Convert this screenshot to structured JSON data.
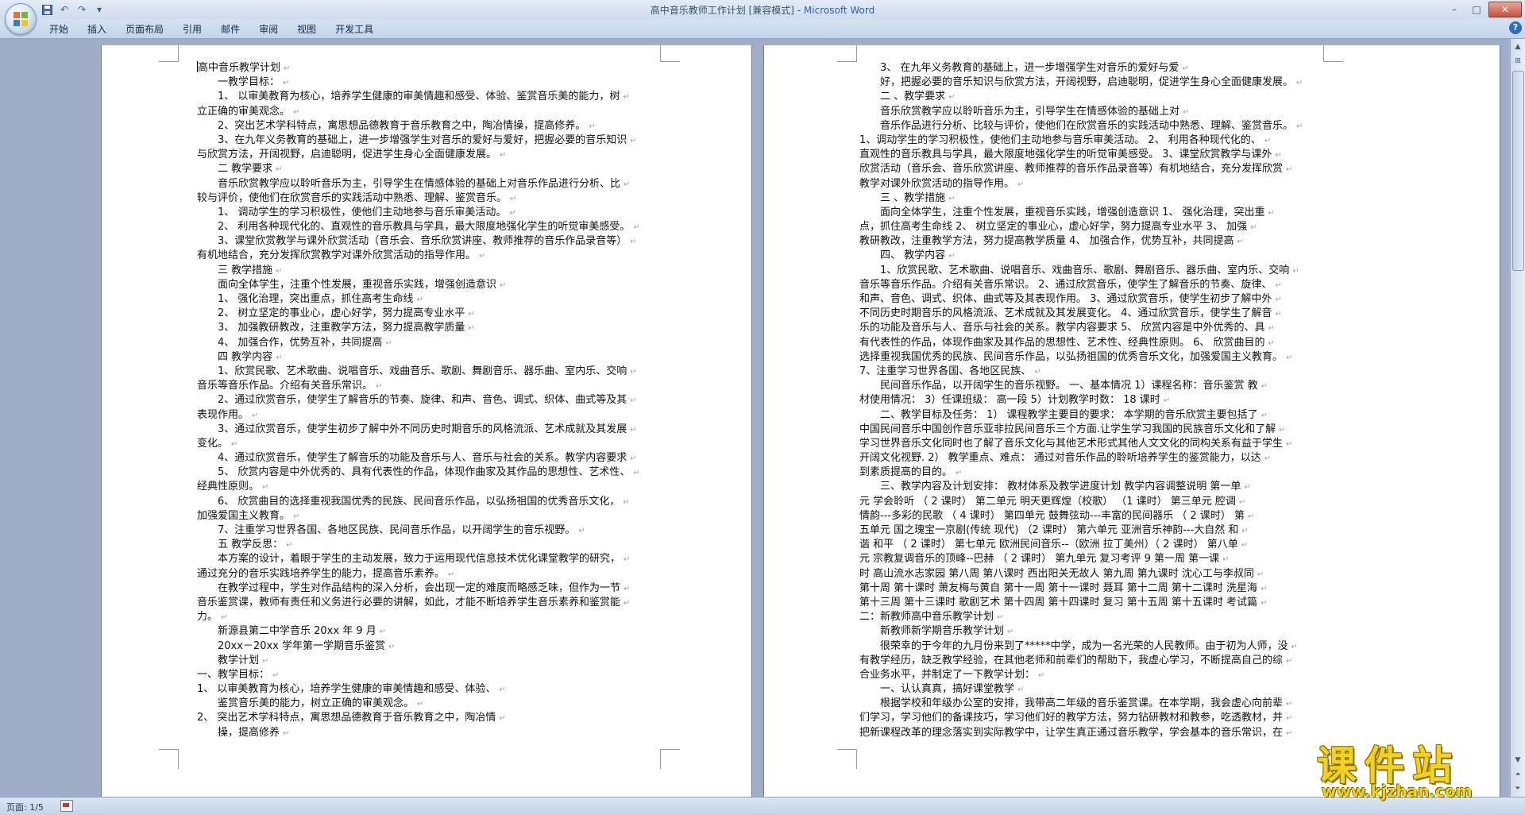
{
  "window": {
    "title_prefix": "高中音乐教师工作计划 [兼容模式] - ",
    "title_app": "Microsoft Word"
  },
  "quick_access": [
    "save-icon",
    "undo-icon",
    "redo-icon",
    "customize-icon"
  ],
  "window_controls": {
    "minimize": "–",
    "maximize": "□",
    "close": "✕"
  },
  "ribbon": {
    "tabs": [
      "开始",
      "插入",
      "页面布局",
      "引用",
      "邮件",
      "审阅",
      "视图",
      "开发工具"
    ],
    "help": "?"
  },
  "colors": {
    "ribbon_bg": "#c3d4ea",
    "doc_bg": "#9faec6",
    "close_btn": "#c4513d",
    "watermark": "#f2d21a"
  },
  "left_page": {
    "lines": [
      {
        "t": "高中音乐教学计划",
        "i": 0
      },
      {
        "t": "一教学目标：",
        "i": 1
      },
      {
        "t": "1、 以审美教育为核心，培养学生健康的审美情趣和感受、体验、鉴赏音乐美的能力，树",
        "i": 1
      },
      {
        "t": "立正确的审美观念。",
        "i": 0
      },
      {
        "t": "2、突出艺术学科特点，寓思想品德教育于音乐教育之中，陶冶情操，提高修养。",
        "i": 1
      },
      {
        "t": "3、在九年义务教育的基础上，进一步增强学生对音乐的爱好与爱好，把握必要的音乐知识",
        "i": 1
      },
      {
        "t": "与欣赏方法，开阔视野，启迪聪明，促进学生身心全面健康发展。",
        "i": 0
      },
      {
        "t": "二 教学要求",
        "i": 1
      },
      {
        "t": "音乐欣赏教学应以聆听音乐为主，引导学生在情感体验的基础上对音乐作品进行分析、比",
        "i": 1
      },
      {
        "t": "较与评价，使他们在欣赏音乐的实践活动中熟悉、理解、鉴赏音乐。",
        "i": 0
      },
      {
        "t": "1、  调动学生的学习积极性，使他们主动地参与音乐审美活动。",
        "i": 1
      },
      {
        "t": "2、  利用各种现代化的、直观性的音乐教具与学具，最大限度地强化学生的听觉审美感受。",
        "i": 1
      },
      {
        "t": "3、课堂欣赏教学与课外欣赏活动（音乐会、音乐欣赏讲座、教师推荐的音乐作品录音等）",
        "i": 1
      },
      {
        "t": "有机地结合，充分发挥欣赏教学对课外欣赏活动的指导作用。",
        "i": 0
      },
      {
        "t": "三 教学措施",
        "i": 1
      },
      {
        "t": "面向全体学生，注重个性发展，重视音乐实践，增强创造意识",
        "i": 1
      },
      {
        "t": "1、   强化治理，突出重点，抓住高考生命线",
        "i": 1
      },
      {
        "t": "2、   树立坚定的事业心，虚心好学，努力提高专业水平",
        "i": 1
      },
      {
        "t": "3、   加强教研教改，注重教学方法，努力提高教学质量",
        "i": 1
      },
      {
        "t": "4、   加强合作，优势互补，共同提高",
        "i": 1
      },
      {
        "t": "四 教学内容",
        "i": 1
      },
      {
        "t": "1、欣赏民歌、艺术歌曲、说唱音乐、戏曲音乐、歌剧、舞剧音乐、器乐曲、室内乐、交响",
        "i": 1
      },
      {
        "t": "音乐等音乐作品。介绍有关音乐常识。",
        "i": 0
      },
      {
        "t": "2、通过欣赏音乐，使学生了解音乐的节奏、旋律、和声、音色、调式、织体、曲式等及其",
        "i": 1
      },
      {
        "t": "表现作用。",
        "i": 0
      },
      {
        "t": "3、通过欣赏音乐，使学生初步了解中外不同历史时期音乐的风格流派、艺术成就及其发展",
        "i": 1
      },
      {
        "t": "变化。",
        "i": 0
      },
      {
        "t": "4、通过欣赏音乐，使学生了解音乐的功能及音乐与人、音乐与社会的关系。教学内容要求",
        "i": 1
      },
      {
        "t": "5、  欣赏内容是中外优秀的、具有代表性的作品，体现作曲家及其作品的思想性、艺术性、",
        "i": 1
      },
      {
        "t": "经典性原则。",
        "i": 0
      },
      {
        "t": "6、  欣赏曲目的选择重视我国优秀的民族、民间音乐作品，以弘扬祖国的优秀音乐文化，",
        "i": 1
      },
      {
        "t": "加强爱国主义教育。",
        "i": 0
      },
      {
        "t": "7、注重学习世界各国、各地区民族、民间音乐作品，以开阔学生的音乐视野。",
        "i": 1
      },
      {
        "t": "五 教学反思：",
        "i": 1
      },
      {
        "t": "本方案的设计，着眼于学生的主动发展，致力于运用现代信息技术优化课堂教学的研究，",
        "i": 1
      },
      {
        "t": "通过充分的音乐实践培养学生的能力，提高音乐素养。",
        "i": 0
      },
      {
        "t": "在教学过程中，学生对作品结构的深入分析，会出现一定的难度而略感乏味，但作为一节",
        "i": 1
      },
      {
        "t": "音乐鉴赏课，教师有责任和义务进行必要的讲解，如此，才能不断培养学生音乐素养和鉴赏能",
        "i": 0
      },
      {
        "t": "力。",
        "i": 0
      },
      {
        "t": "新源县第二中学音乐                                   20xx 年 9 月",
        "i": 1
      },
      {
        "t": "20xx－20xx 学年第一学期音乐鉴赏",
        "i": 1
      },
      {
        "t": "教学计划",
        "i": 1
      },
      {
        "t": "一、教学目标：",
        "i": 0
      },
      {
        "t": "1、  以审美教育为核心，培养学生健康的审美情趣和感受、体验、",
        "i": 0
      },
      {
        "t": "鉴赏音乐美的能力，树立正确的审美观念。",
        "i": 1
      },
      {
        "t": "2、  突出艺术学科特点，寓思想品德教育于音乐教育之中，陶冶情",
        "i": 0
      },
      {
        "t": "操，提高修养",
        "i": 1
      }
    ]
  },
  "right_page": {
    "lines": [
      {
        "t": "3、 在九年义务教育的基础上，进一步增强学生对音乐的爱好与爱",
        "i": 1
      },
      {
        "t": "好，把握必要的音乐知识与欣赏方法，开阔视野，启迪聪明，促进学生身心全面健康发展。",
        "i": 1
      },
      {
        "t": "二 、教学要求",
        "i": 1
      },
      {
        "t": "音乐欣赏教学应以聆听音乐为主，引导学生在情感体验的基础上对",
        "i": 1
      },
      {
        "t": "音乐作品进行分析、比较与评价，使他们在欣赏音乐的实践活动中熟悉、理解、鉴赏音乐。",
        "i": 1
      },
      {
        "t": "1、调动学生的学习积极性，使他们主动地参与音乐审美活动。      2、  利用各种现代化的、",
        "i": 0
      },
      {
        "t": "直观性的音乐教具与学具，最大限度地强化学生的听觉审美感受。      3、课堂欣赏教学与课外",
        "i": 0
      },
      {
        "t": "欣赏活动（音乐会、音乐欣赏讲座、教师推荐的音乐作品录音等）有机地结合，充分发挥欣赏",
        "i": 0
      },
      {
        "t": "教学对课外欣赏活动的指导作用。",
        "i": 0
      },
      {
        "t": "三 、教学措施",
        "i": 1
      },
      {
        "t": "面向全体学生，注重个性发展，重视音乐实践，增强创造意识    1、   强化治理，突出重",
        "i": 1
      },
      {
        "t": "点，抓住高考生命线      2、   树立坚定的事业心，虚心好学，努力提高专业水平      3、   加强",
        "i": 0
      },
      {
        "t": "教研教改，注重教学方法，努力提高教学质量     4、   加强合作，优势互补，共同提高",
        "i": 0
      },
      {
        "t": "四、 教学内容",
        "i": 1
      },
      {
        "t": "1、欣赏民歌、艺术歌曲、说唱音乐、戏曲音乐、歌剧、舞剧音乐、器乐曲、室内乐、交响",
        "i": 1
      },
      {
        "t": "音乐等音乐作品。介绍有关音乐常识。      2、通过欣赏音乐，使学生了解音乐的节奏、旋律、",
        "i": 0
      },
      {
        "t": "和声、音色、调式、织体、曲式等及其表现作用。      3、通过欣赏音乐，使学生初步了解中外",
        "i": 0
      },
      {
        "t": "不同历史时期音乐的风格流派、艺术成就及其发展变化。      4、通过欣赏音乐，使学生了解音",
        "i": 0
      },
      {
        "t": "乐的功能及音乐与人、音乐与社会的关系。教学内容要求      5、  欣赏内容是中外优秀的、具",
        "i": 0
      },
      {
        "t": "有代表性的作品，体现作曲家及其作品的思想性、艺术性、经典性原则。      6、  欣赏曲目的",
        "i": 0
      },
      {
        "t": "选择重视我国优秀的民族、民间音乐作品，以弘扬祖国的优秀音乐文化，加强爱国主义教育。",
        "i": 0
      },
      {
        "t": "7、注重学习世界各国、各地区民族、",
        "i": 0
      },
      {
        "t": "民间音乐作品，以开阔学生的音乐视野。      一、基本情况    1）课程名称：音乐鉴赏 教",
        "i": 1
      },
      {
        "t": "材使用情况：  3）任课班级： 高一段    5）计划教学时数： 18 课时",
        "i": 0
      },
      {
        "t": "二、教学目标及任务：   1） 课程教学主要目的要求：     本学期的音乐欣赏主要包括了",
        "i": 1
      },
      {
        "t": "中国民间音乐中国创作音乐亚非拉民间音乐三个方面.让学生学习我国的民族音乐文化和了解",
        "i": 0
      },
      {
        "t": "学习世界音乐文化同时也了解了音乐文化与其他艺术形式其他人文文化的同构关系有益于学生",
        "i": 0
      },
      {
        "t": "开阔文化视野.   2） 教学重点、难点：      通过对音乐作品的聆听培养学生的鉴赏能力，以达",
        "i": 0
      },
      {
        "t": "到素质提高的目的。",
        "i": 0
      },
      {
        "t": "三、教学内容及计划安排：      教材体系及教学进度计划    教学内容调整说明      第一单",
        "i": 1
      },
      {
        "t": "元 学会聆听   （ 2 课时）     第二单元   明天更辉煌（校歌）    （1 课时）     第三单元   腔调",
        "i": 0
      },
      {
        "t": "情韵---多彩的民歌   （ 4 课时）     第四单元   鼓舞弦动---丰富的民间器乐   （ 2 课时）    第",
        "i": 0
      },
      {
        "t": "五单元   国之瑰宝一京剧(传统  现代)    （2 课时）     第六单元   亚洲音乐神韵---大自然 和",
        "i": 0
      },
      {
        "t": "谐  和平   （ 2 课时）     第七单元   欧洲民间音乐--（欧洲  拉丁美州）（ 2 课时）    第八单",
        "i": 0
      },
      {
        "t": "元   宗教复调音乐的顶峰--巴赫      （ 2 课时）     第九单元   复习考评    9     第一周 第一课",
        "i": 0
      },
      {
        "t": "时 高山流水志家园   第八周 第八课时 西出阳关无故人    第九周 第九课时 沈心工与李叔同",
        "i": 0
      },
      {
        "t": "第十周 第十课时  萧友梅与黄自    第十一周 第十一课时 聂耳    第十二周 第十二课时 洗星海",
        "i": 0
      },
      {
        "t": "第十三周 第十三课时 歌剧艺术   第十四周 第十四课时 复习    第十五周 第十五课时 考试篇",
        "i": 0
      },
      {
        "t": "二：新教师高中音乐教学计划",
        "i": 0
      },
      {
        "t": "新教师新学期音乐教学计划",
        "i": 1
      },
      {
        "t": "很荣幸的于今年的九月份来到了*****中学，成为一名光荣的人民教师。由于初为人师，没",
        "i": 1
      },
      {
        "t": "有教学经历，缺乏教学经验，在其他老师和前辈们的帮助下，我虚心学习，不断提高自己的综",
        "i": 0
      },
      {
        "t": "合业务水平，并制定了一下教学计划：",
        "i": 0
      },
      {
        "t": "一、认认真真，搞好课堂教学",
        "i": 1
      },
      {
        "t": "根据学校和年级办公室的安排，我带高二年级的音乐鉴赏课。在本学期，我会虚心向前辈",
        "i": 1
      },
      {
        "t": "们学习，学习他们的备课技巧，学习他们好的教学方法，努力钻研教材和教参，吃透教材，并",
        "i": 0
      },
      {
        "t": "把新课程改革的理念落实到实际教学中，让学生真正通过音乐教学，学会基本的音乐常识，在",
        "i": 0
      }
    ]
  },
  "status": {
    "page": "页面: 1/5"
  },
  "watermark": {
    "title": "课件站",
    "url": "www.kjzhan.com"
  }
}
